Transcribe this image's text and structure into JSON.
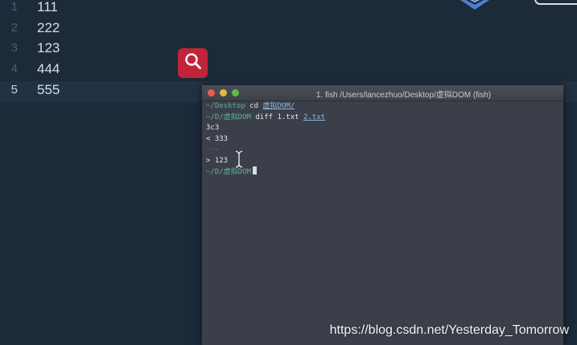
{
  "editor": {
    "lines": [
      {
        "number": "1",
        "text": "111"
      },
      {
        "number": "2",
        "text": "222"
      },
      {
        "number": "3",
        "text": "123"
      },
      {
        "number": "4",
        "text": "444"
      },
      {
        "number": "5",
        "text": "555"
      }
    ],
    "active_line": 5
  },
  "search": {
    "icon": "search-icon",
    "color": "#c0243a"
  },
  "terminal": {
    "title": "1. fish  /Users/lancezhuo/Desktop/虚拟DOM (fish)",
    "lines": [
      {
        "prompt": "~/Desktop",
        "command": "cd",
        "arg": "虚拟DOM/"
      },
      {
        "prompt": "~/D/虚拟DOM",
        "command": "diff 1.txt",
        "arg": "2.txt"
      },
      {
        "output": "3c3"
      },
      {
        "output": "< 333"
      },
      {
        "output": "---"
      },
      {
        "output": "> 123"
      },
      {
        "prompt": "~/D/虚拟DOM"
      }
    ],
    "colors": {
      "prompt": "#5fb28f",
      "close": "#ec5b56",
      "minimize": "#e8b93b",
      "zoom": "#5cbc4b"
    }
  },
  "watermark": {
    "text": "https://blog.csdn.net/Yesterday_Tomorrow"
  }
}
